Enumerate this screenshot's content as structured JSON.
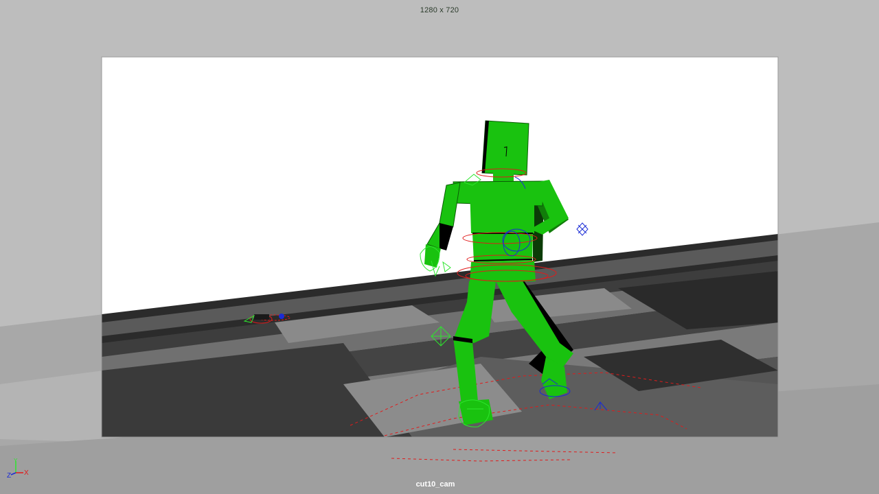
{
  "viewport": {
    "resolution_label": "1280 x 720",
    "camera_label": "cut10_cam",
    "axis_labels": {
      "x": "X",
      "y": "Y",
      "z": "Z"
    },
    "colors": {
      "background": "#bdbdbd",
      "sky": "#ffffff",
      "character_green": "#19c20f",
      "character_shadow": "#000000",
      "control_red": "#e01b1b",
      "control_blue": "#1a2bd6",
      "control_green": "#2ee62e"
    },
    "icons": {
      "axis": "axis-gizmo-icon",
      "locator": "locator-icon",
      "pole_vector": "pole-vector-icon"
    }
  }
}
